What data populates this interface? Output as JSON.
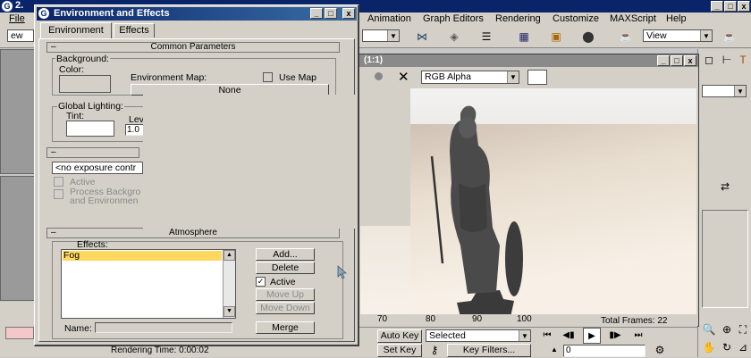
{
  "app": {
    "title_fragment": "2.",
    "logo_letter": "G"
  },
  "menu": {
    "items": [
      "File",
      "Animation",
      "Graph Editors",
      "Rendering",
      "Customize",
      "MAXScript",
      "Help"
    ],
    "view_dropdown": "View",
    "left_dropdown": "ew"
  },
  "env_dialog": {
    "title": "Environment and Effects",
    "tabs": [
      "Environment",
      "Effects"
    ],
    "common_params": {
      "header": "Common Parameters",
      "background_label": "Background:",
      "color_label": "Color:",
      "env_map_label": "Environment Map:",
      "use_map_label": "Use Map",
      "none_button": "None",
      "global_lighting_label": "Global Lighting:",
      "tint_label": "Tint:",
      "level_label": "Lev",
      "level_value": "1.0"
    },
    "exposure": {
      "dropdown": "<no exposure contr",
      "active_label": "Active",
      "process_bg_label_1": "Process Backgro",
      "process_bg_label_2": "and Environmen"
    },
    "atmosphere": {
      "header": "Atmosphere",
      "effects_label": "Effects:",
      "effects_list": [
        "Fog"
      ],
      "add_button": "Add...",
      "delete_button": "Delete",
      "active_label": "Active",
      "move_up_button": "Move Up",
      "move_down_button": "Move Down",
      "name_label": "Name:",
      "merge_button": "Merge"
    }
  },
  "render_window": {
    "title_fragment": "(1:1)",
    "channel_dropdown": "RGB Alpha"
  },
  "bottom": {
    "timeline_ticks": [
      "70",
      "80",
      "90",
      "100"
    ],
    "rendering_time": "Rendering Time: 0:00:02",
    "total_frames": "Total Frames: 22",
    "auto_key_button": "Auto Key",
    "set_key_button": "Set Key",
    "selected_dropdown": "Selected",
    "key_filters_button": "Key Filters...",
    "frame_field": "0"
  }
}
